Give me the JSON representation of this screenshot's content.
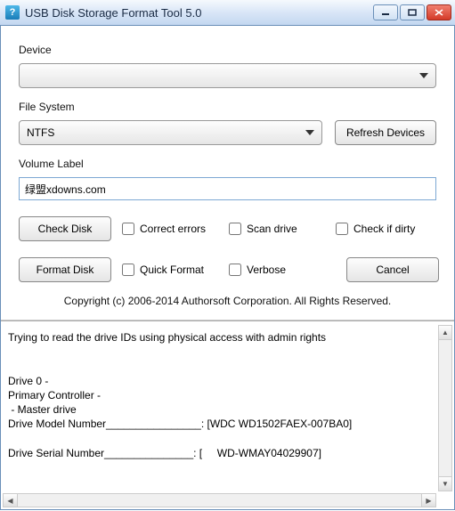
{
  "window": {
    "title": "USB Disk Storage Format Tool 5.0"
  },
  "labels": {
    "device": "Device",
    "file_system": "File System",
    "volume_label": "Volume Label"
  },
  "device_combo": {
    "value": ""
  },
  "fs_combo": {
    "value": "NTFS"
  },
  "volume_input": {
    "value": "绿盟xdowns.com"
  },
  "buttons": {
    "refresh": "Refresh Devices",
    "check_disk": "Check Disk",
    "format_disk": "Format Disk",
    "cancel": "Cancel"
  },
  "checkboxes": {
    "correct_errors": "Correct errors",
    "scan_drive": "Scan drive",
    "check_if_dirty": "Check if dirty",
    "quick_format": "Quick Format",
    "verbose": "Verbose"
  },
  "copyright": "Copyright (c) 2006-2014 Authorsoft Corporation. All Rights Reserved.",
  "log": "Trying to read the drive IDs using physical access with admin rights\n\n\nDrive 0 -\nPrimary Controller -\n - Master drive\nDrive Model Number________________: [WDC WD1502FAEX-007BA0]\n\nDrive Serial Number_______________: [     WD-WMAY04029907]"
}
